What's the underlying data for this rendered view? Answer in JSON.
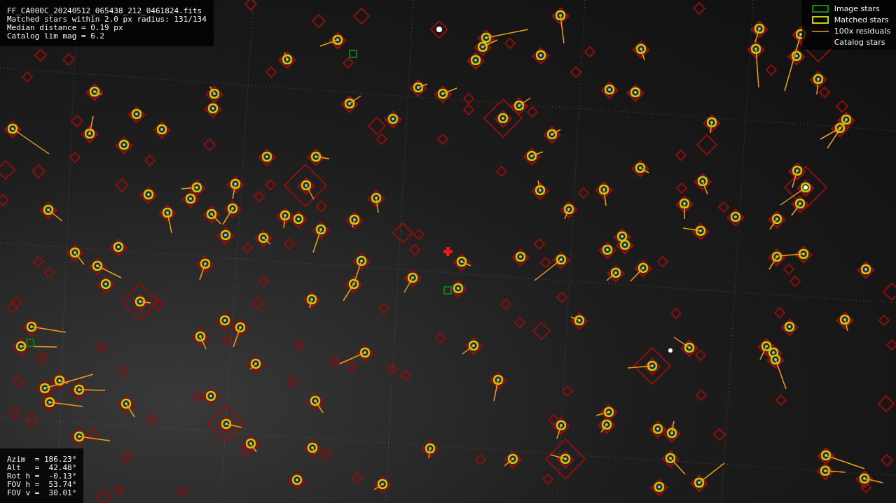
{
  "header": {
    "lines": [
      "FF_CA000C_20240512_065438_212_0461824.fits",
      "Matched stars within 2.0 px radius: 131/134",
      "Median distance = 0.19 px",
      "Catalog lim mag = 6.2"
    ]
  },
  "legend": [
    {
      "label": "Image stars",
      "kind": "image"
    },
    {
      "label": "Matched stars",
      "kind": "matched"
    },
    {
      "label": "100x residuals",
      "kind": "residual"
    },
    {
      "label": "Catalog stars",
      "kind": "catalog"
    }
  ],
  "pointing": {
    "lines": [
      "Azim  = 186.23°",
      "Alt   =  42.48°",
      "Rot h =  -0.13°",
      "FOV h =  53.74°",
      "FOV v =  30.01°"
    ]
  }
}
